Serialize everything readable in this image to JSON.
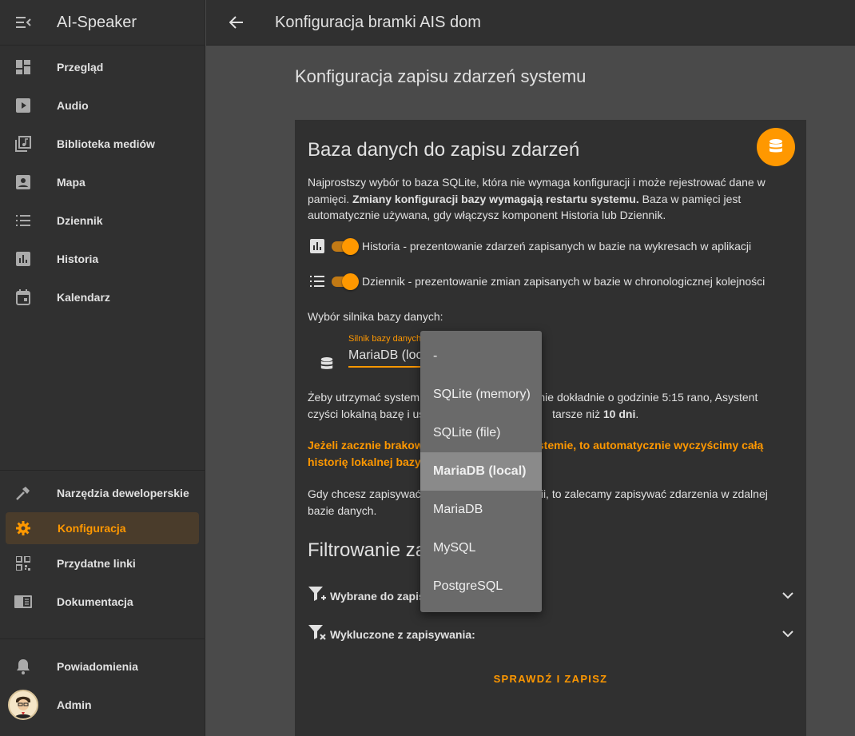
{
  "app": {
    "title": "AI-Speaker"
  },
  "sidebar": {
    "items": [
      {
        "label": "Przegląd",
        "icon": "dashboard-icon"
      },
      {
        "label": "Audio",
        "icon": "play-box-icon"
      },
      {
        "label": "Biblioteka mediów",
        "icon": "music-library-icon"
      },
      {
        "label": "Mapa",
        "icon": "account-box-icon"
      },
      {
        "label": "Dziennik",
        "icon": "list-icon"
      },
      {
        "label": "Historia",
        "icon": "chart-box-icon"
      },
      {
        "label": "Kalendarz",
        "icon": "calendar-icon"
      }
    ],
    "bottom_items": [
      {
        "label": "Narzędzia deweloperskie",
        "icon": "hammer-icon"
      },
      {
        "label": "Konfiguracja",
        "icon": "gear-icon",
        "active": true
      },
      {
        "label": "Przydatne linki",
        "icon": "qrcode-icon"
      },
      {
        "label": "Dokumentacja",
        "icon": "book-icon"
      }
    ],
    "notifications": "Powiadomienia",
    "user": "Admin"
  },
  "topbar": {
    "title": "Konfiguracja bramki AIS dom"
  },
  "page": {
    "heading": "Konfiguracja zapisu zdarzeń systemu",
    "card": {
      "title": "Baza danych do zapisu zdarzeń",
      "intro_1": "Najprostszy wybór to baza SQLite, która nie wymaga konfiguracji i może rejestrować dane w pamięci.",
      "intro_bold": "Zmiany konfiguracji bazy wymagają restartu systemu.",
      "intro_2": "Baza w pamięci jest automatycznie używana, gdy włączysz komponent Historia lub Dziennik.",
      "toggle_history": "Historia - prezentowanie zdarzeń zapisanych w bazie na wykresach w aplikacji",
      "toggle_log": "Dziennik - prezentowanie zmian zapisanych w bazie w chronologicznej kolejności",
      "engine_label": "Wybór silnika bazy danych:",
      "field_label": "Silnik bazy danych",
      "field_value": "MariaDB (local)",
      "cleanup_1": "Żeby utrzymać system",
      "cleanup_2": "ennie dokładnie o godzinie 5:15 rano, Asystent",
      "cleanup_3": "czyści lokalną bazę i us",
      "cleanup_4": "tarsze niż",
      "cleanup_bold": "10 dni",
      "cleanup_end": ".",
      "warn_1a": "Jeżeli zacznie brakowa",
      "warn_1b": "systemie, to automatycznie wyczyścimy całą",
      "warn_2": "historię lokalnej bazy, ",
      "remote_1a": "Gdy chcesz zapisywać",
      "remote_1b": "orii, to zalecamy zapisywać zdarzenia w zdalnej",
      "remote_2": "bazie danych.",
      "filter_title": "Filtrowanie za",
      "include_label": "Wybrane do zapisy",
      "exclude_label": "Wykluczone z zapisywania:",
      "save_button": "SPRAWDŹ I ZAPISZ"
    }
  },
  "dropdown": {
    "options": [
      "-",
      "SQLite (memory)",
      "SQLite (file)",
      "MariaDB (local)",
      "MariaDB",
      "MySQL",
      "PostgreSQL"
    ],
    "selected": "MariaDB (local)"
  },
  "colors": {
    "accent": "#ff9800",
    "sidebar_bg": "#303030",
    "main_bg": "#4a4a4a"
  }
}
